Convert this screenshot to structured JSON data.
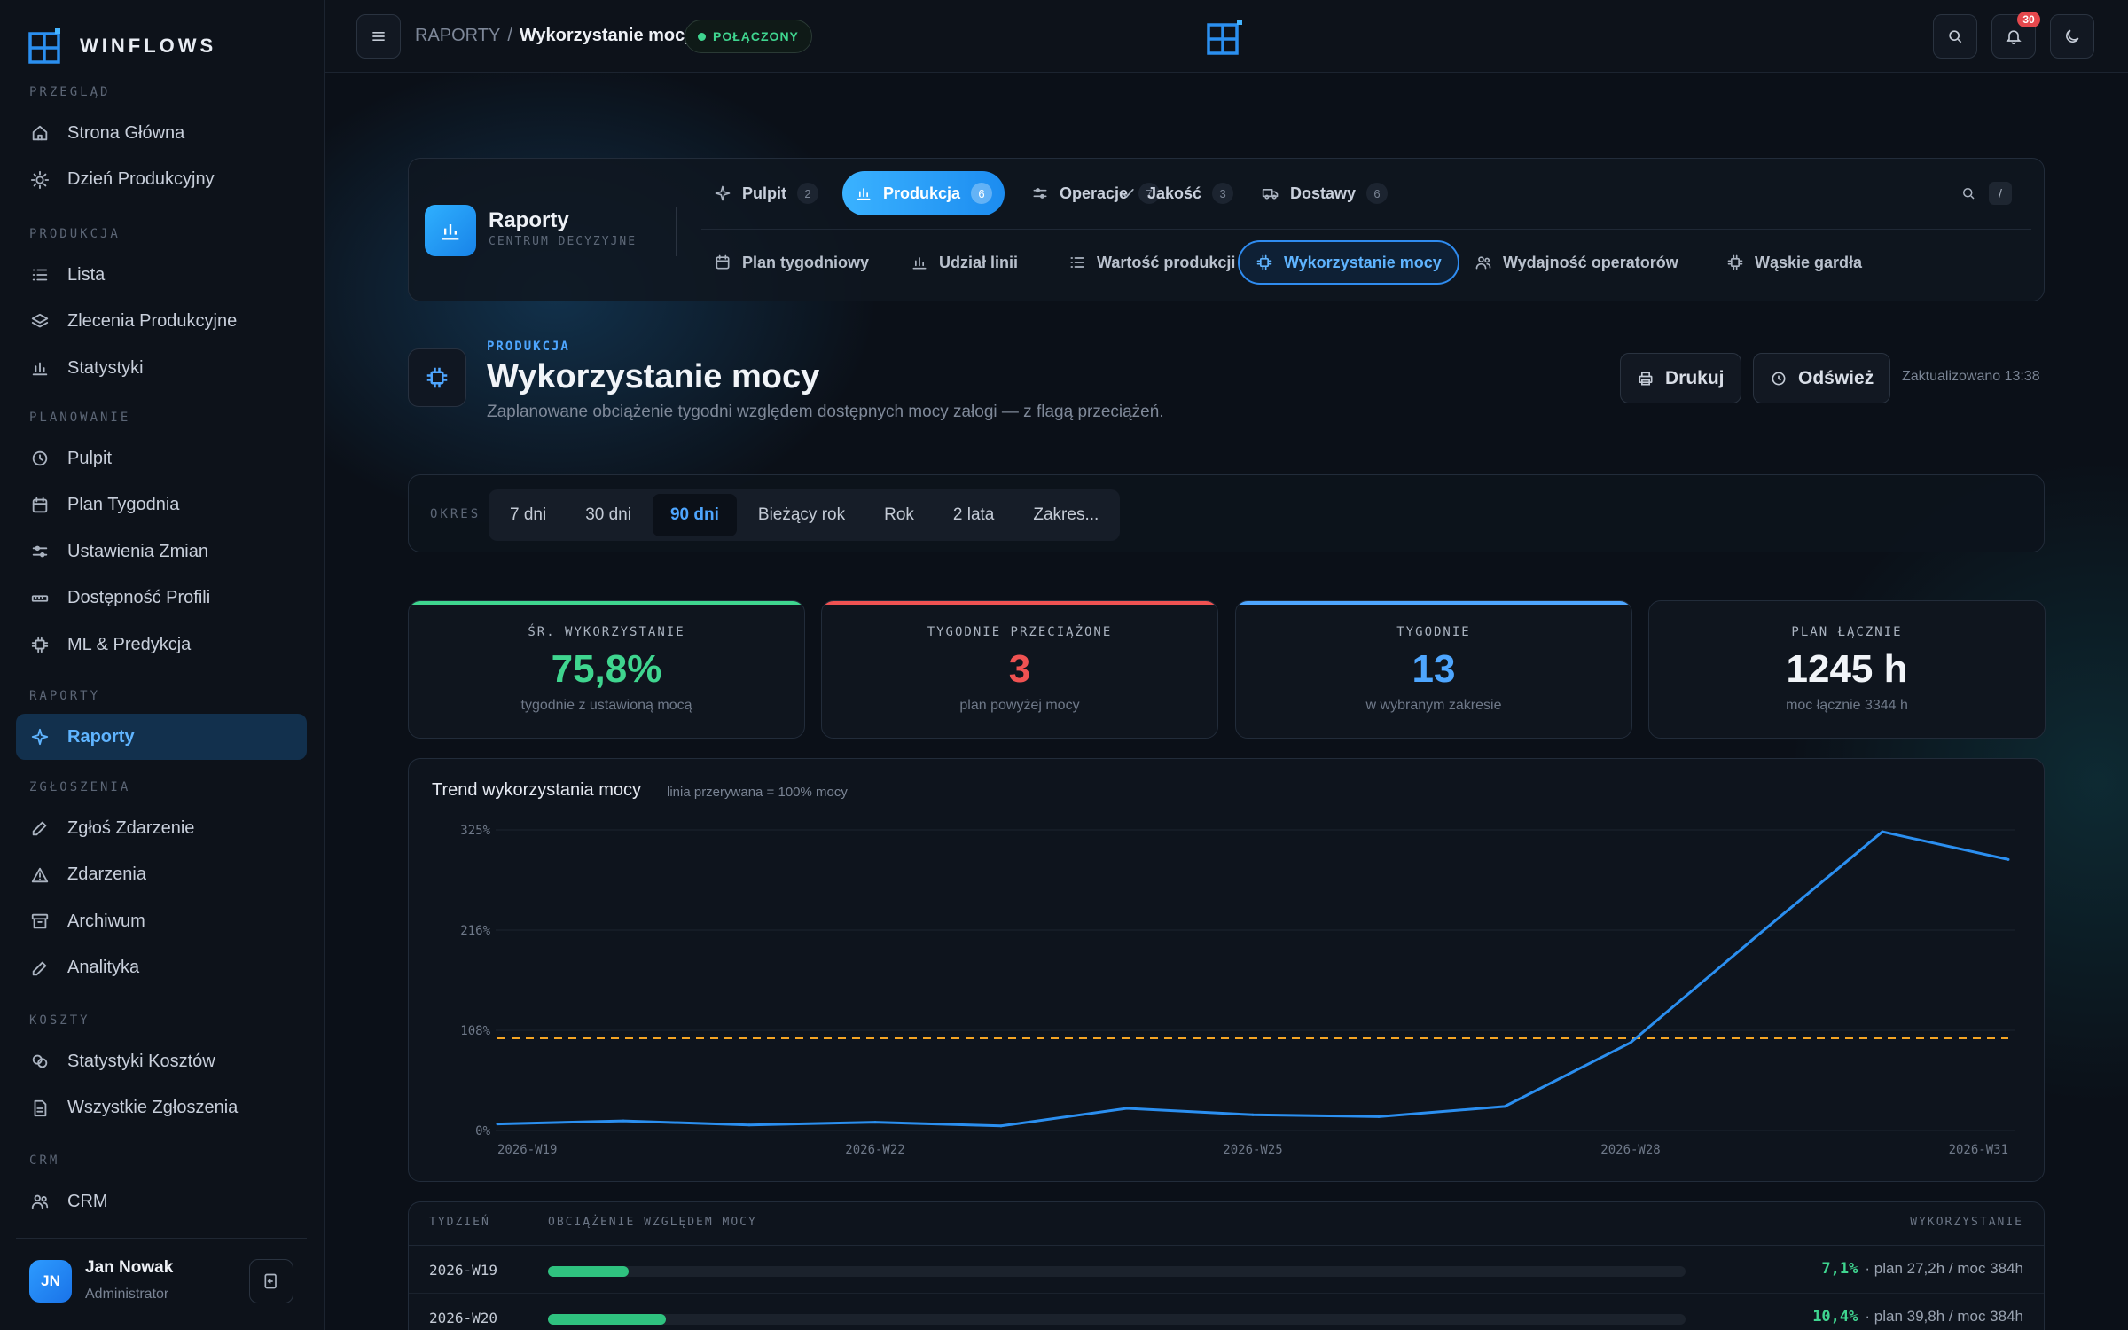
{
  "sidebar": {
    "brand": "WINFLOWS",
    "sections": [
      {
        "title": "PRZEGLĄD",
        "items": [
          {
            "label": "Strona Główna",
            "icon": "home-icon"
          },
          {
            "label": "Dzień Produkcyjny",
            "icon": "sun-icon"
          }
        ]
      },
      {
        "title": "PRODUKCJA",
        "items": [
          {
            "label": "Lista",
            "icon": "list-icon"
          },
          {
            "label": "Zlecenia Produkcyjne",
            "icon": "layers-icon"
          },
          {
            "label": "Statystyki",
            "icon": "bar-chart-icon"
          }
        ]
      },
      {
        "title": "PLANOWANIE",
        "items": [
          {
            "label": "Pulpit",
            "icon": "clock-icon"
          },
          {
            "label": "Plan Tygodnia",
            "icon": "calendar-icon"
          },
          {
            "label": "Ustawienia Zmian",
            "icon": "sliders-icon"
          },
          {
            "label": "Dostępność Profili",
            "icon": "ruler-icon"
          },
          {
            "label": "ML & Predykcja",
            "icon": "chip-icon"
          }
        ]
      },
      {
        "title": "RAPORTY",
        "items": [
          {
            "label": "Raporty",
            "icon": "sparkle-icon",
            "active": true
          }
        ]
      },
      {
        "title": "ZGŁOSZENIA",
        "items": [
          {
            "label": "Zgłoś Zdarzenie",
            "icon": "pen-icon"
          },
          {
            "label": "Zdarzenia",
            "icon": "warning-icon"
          },
          {
            "label": "Archiwum",
            "icon": "archive-icon"
          },
          {
            "label": "Analityka",
            "icon": "pen-icon"
          }
        ]
      },
      {
        "title": "KOSZTY",
        "items": [
          {
            "label": "Statystyki Kosztów",
            "icon": "coins-icon"
          },
          {
            "label": "Wszystkie Zgłoszenia",
            "icon": "document-icon"
          }
        ]
      },
      {
        "title": "CRM",
        "items": [
          {
            "label": "CRM",
            "icon": "users-icon"
          }
        ]
      }
    ],
    "user": {
      "initials": "JN",
      "name": "Jan Nowak",
      "role": "Administrator"
    }
  },
  "topbar": {
    "crumb_parent": "RAPORTY",
    "crumb_sep": "/",
    "crumb_current": "Wykorzystanie mocy",
    "status": "POŁĄCZONY",
    "notifications": "30"
  },
  "report_nav": {
    "title": "Raporty",
    "subtitle": "CENTRUM DECYZYJNE",
    "tabs": [
      {
        "label": "Pulpit",
        "count": "2",
        "icon": "sparkle-icon"
      },
      {
        "label": "Produkcja",
        "count": "6",
        "icon": "bar-chart-icon",
        "active": true
      },
      {
        "label": "Operacje",
        "count": "7",
        "icon": "sliders-icon"
      },
      {
        "label": "Jakość",
        "count": "3",
        "icon": "check-icon"
      },
      {
        "label": "Dostawy",
        "count": "6",
        "icon": "truck-icon"
      }
    ],
    "search_shortcut": "/",
    "subtabs": [
      {
        "label": "Plan tygodniowy",
        "icon": "calendar-icon"
      },
      {
        "label": "Udział linii",
        "icon": "bar-chart-icon"
      },
      {
        "label": "Wartość produkcji",
        "icon": "list-icon"
      },
      {
        "label": "Wykorzystanie mocy",
        "icon": "chip-icon",
        "active": true
      },
      {
        "label": "Wydajność operatorów",
        "icon": "users-icon"
      },
      {
        "label": "Wąskie gardła",
        "icon": "chip-icon"
      }
    ]
  },
  "page": {
    "eyebrow": "PRODUKCJA",
    "title": "Wykorzystanie mocy",
    "description": "Zaplanowane obciążenie tygodni względem dostępnych mocy załogi — z flagą przeciążeń.",
    "print_label": "Drukuj",
    "refresh_label": "Odśwież",
    "updated": "Zaktualizowano 13:38"
  },
  "period": {
    "label": "OKRES",
    "options": [
      "7 dni",
      "30 dni",
      "90 dni",
      "Bieżący rok",
      "Rok",
      "2 lata",
      "Zakres..."
    ],
    "selected": "90 dni"
  },
  "kpis": [
    {
      "label": "ŚR. WYKORZYSTANIE",
      "value": "75,8%",
      "sub": "tygodnie z ustawioną mocą",
      "color": "#3fd58f"
    },
    {
      "label": "TYGODNIE PRZECIĄŻONE",
      "value": "3",
      "sub": "plan powyżej mocy",
      "color": "#f05252"
    },
    {
      "label": "TYGODNIE",
      "value": "13",
      "sub": "w wybranym zakresie",
      "color": "#4ea6ff"
    },
    {
      "label": "PLAN ŁĄCZNIE",
      "value": "1245 h",
      "sub": "moc łącznie 3344 h",
      "color": "#f1f4f8"
    }
  ],
  "chart": {
    "title": "Trend wykorzystania mocy",
    "note": "linia przerywana = 100% mocy"
  },
  "chart_data": {
    "type": "line",
    "x": [
      "2026-W19",
      "2026-W20",
      "2026-W21",
      "2026-W22",
      "2026-W23",
      "2026-W24",
      "2026-W25",
      "2026-W26",
      "2026-W27",
      "2026-W28",
      "2026-W29",
      "2026-W30",
      "2026-W31"
    ],
    "x_tick_labels": [
      "2026-W19",
      "2026-W22",
      "2026-W25",
      "2026-W28",
      "2026-W31"
    ],
    "series": [
      {
        "values": [
          7.1,
          10.4,
          6,
          9,
          5,
          24,
          17,
          15,
          26,
          95,
          210,
          323,
          293
        ],
        "color": "#2b8ff0"
      }
    ],
    "reference_line": {
      "value": 100,
      "color": "#f5a524",
      "style": "dashed"
    },
    "y_ticks": [
      "0%",
      "108%",
      "216%",
      "325%"
    ],
    "ylim": [
      0,
      325
    ],
    "grid": true
  },
  "table": {
    "headers": [
      "TYDZIEŃ",
      "OBCIĄŻENIE WZGLĘDEM MOCY",
      "WYKORZYSTANIE"
    ],
    "rows": [
      {
        "week": "2026-W19",
        "pct": "7,1%",
        "detail": "· plan 27,2h / moc 384h",
        "fill": 0.071
      },
      {
        "week": "2026-W20",
        "pct": "10,4%",
        "detail": "· plan 39,8h / moc 384h",
        "fill": 0.104
      }
    ]
  }
}
